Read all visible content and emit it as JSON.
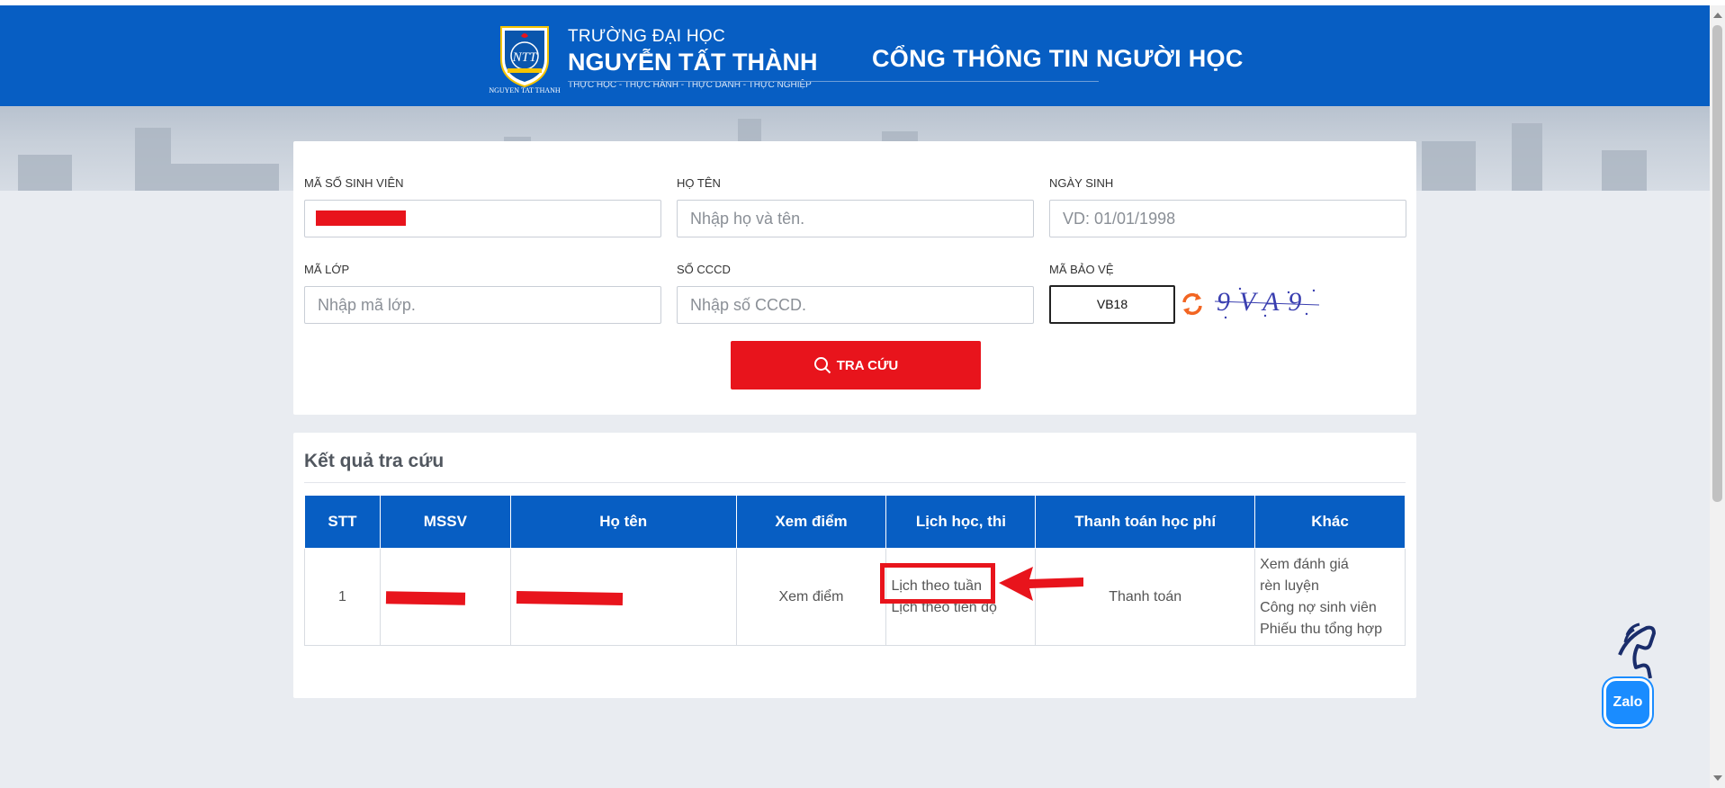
{
  "header": {
    "logo_caption": "NGUYEN TAT THANH",
    "university_line1": "TRƯỜNG ĐẠI HỌC",
    "university_line2": "NGUYỄN TẤT THÀNH",
    "motto": "THỰC HỌC - THỰC HÀNH - THỰC DANH - THỰC NGHIỆP",
    "portal_title": "CỔNG THÔNG TIN NGƯỜI HỌC"
  },
  "search_form": {
    "student_id": {
      "label": "MÃ SỐ SINH VIÊN",
      "value": ""
    },
    "full_name": {
      "label": "HỌ TÊN",
      "placeholder": "Nhập họ và tên."
    },
    "birth_date": {
      "label": "NGÀY SINH",
      "placeholder": "VD: 01/01/1998"
    },
    "class_code": {
      "label": "MÃ LỚP",
      "placeholder": "Nhập mã lớp."
    },
    "citizen_id": {
      "label": "SỐ CCCD",
      "placeholder": "Nhập số CCCD."
    },
    "captcha": {
      "label": "MÃ BẢO VỆ",
      "value": "VB18",
      "image_text": "9VA9"
    },
    "submit_label": "TRA CỨU"
  },
  "results": {
    "title": "Kết quả tra cứu",
    "columns": [
      "STT",
      "MSSV",
      "Họ tên",
      "Xem điểm",
      "Lịch học, thi",
      "Thanh toán học phí",
      "Khác"
    ],
    "rows": [
      {
        "stt": "1",
        "mssv": "",
        "ho_ten": "",
        "xem_diem": "Xem điểm",
        "lich": [
          "Lịch theo tuần",
          "Lịch theo tiến độ"
        ],
        "thanh_toan": "Thanh toán",
        "khac": [
          "Xem đánh giá",
          "rèn luyện",
          "Công nợ sinh viên",
          "Phiếu thu tổng hợp"
        ]
      }
    ]
  },
  "zalo": {
    "label": "Zalo"
  },
  "colors": {
    "primary_blue": "#075ec3",
    "accent_red": "#e8141c",
    "page_bg": "#e9ecf1"
  }
}
